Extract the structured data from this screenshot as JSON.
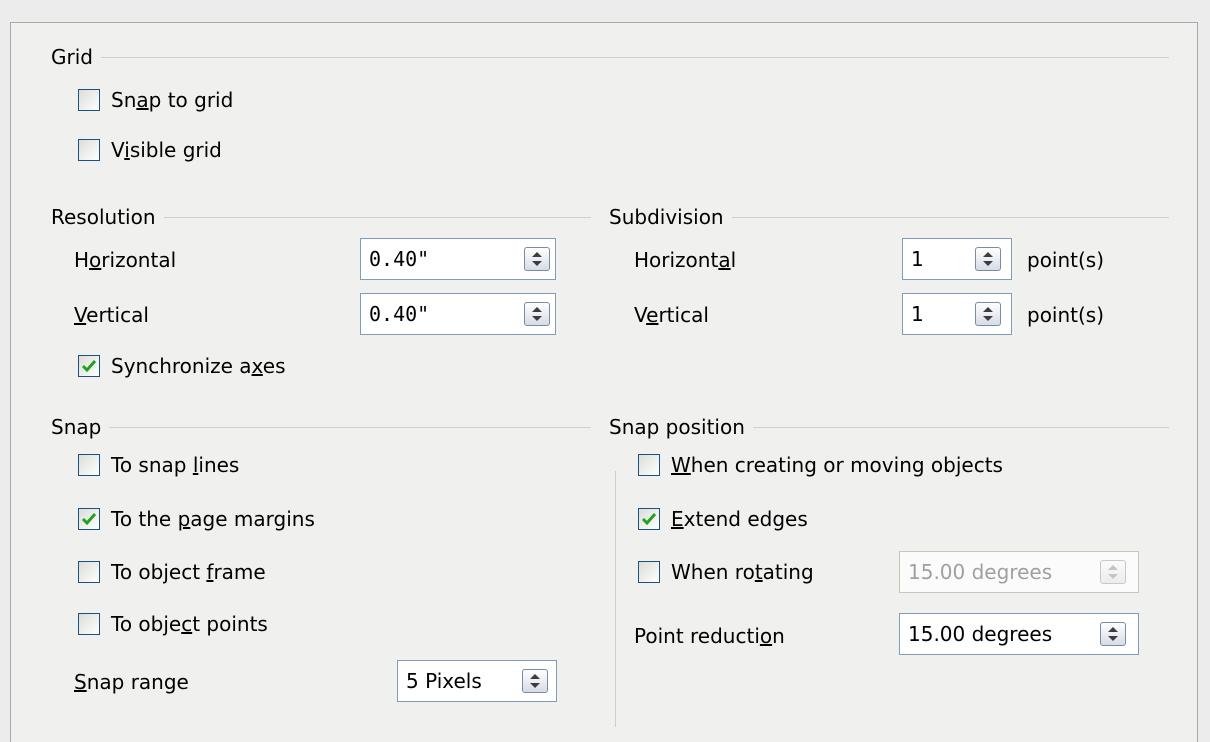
{
  "grid": {
    "title": "Grid",
    "snap_to_grid": {
      "pre": "Sn",
      "key": "a",
      "post": "p to grid",
      "checked": false
    },
    "visible_grid": {
      "pre": "V",
      "key": "i",
      "post": "sible grid",
      "checked": false
    }
  },
  "resolution": {
    "title": "Resolution",
    "horizontal": {
      "pre": "H",
      "key": "o",
      "post": "rizontal",
      "value": "0.40\""
    },
    "vertical": {
      "pre": "",
      "key": "V",
      "post": "ertical",
      "value": "0.40\""
    },
    "sync_axes": {
      "pre": "Synchronize a",
      "key": "x",
      "post": "es",
      "checked": true
    }
  },
  "subdivision": {
    "title": "Subdivision",
    "horizontal": {
      "pre": "Horizont",
      "key": "a",
      "post": "l",
      "value": "1",
      "unit": "point(s)"
    },
    "vertical": {
      "pre": "V",
      "key": "e",
      "post": "rtical",
      "value": "1",
      "unit": "point(s)"
    }
  },
  "snap": {
    "title": "Snap",
    "snap_lines": {
      "pre": "To snap ",
      "key": "l",
      "post": "ines",
      "checked": false
    },
    "page_margins": {
      "pre": "To the ",
      "key": "p",
      "post": "age margins",
      "checked": true
    },
    "object_frame": {
      "pre": "To object ",
      "key": "f",
      "post": "rame",
      "checked": false
    },
    "object_points": {
      "pre": "To obje",
      "key": "c",
      "post": "t points",
      "checked": false
    },
    "snap_range": {
      "pre": "",
      "key": "S",
      "post": "nap range",
      "value": "5 Pixels"
    }
  },
  "snap_position": {
    "title": "Snap position",
    "creating_moving": {
      "pre": "",
      "key": "W",
      "post": "hen creating or moving objects",
      "checked": false
    },
    "extend_edges": {
      "pre": "",
      "key": "E",
      "post": "xtend edges",
      "checked": true
    },
    "when_rotating": {
      "pre": "When ro",
      "key": "t",
      "post": "ating",
      "checked": false,
      "value": "15.00 degrees",
      "enabled": false
    },
    "point_reduction": {
      "pre": "Point reducti",
      "key": "o",
      "post": "n",
      "value": "15.00 degrees"
    }
  },
  "colors": {
    "check": "#21a121",
    "checkbox_border": "#1c5180",
    "field_border": "#7f9db9"
  },
  "icons": {
    "check": "check-icon",
    "spin": "spin-arrows-icon"
  }
}
